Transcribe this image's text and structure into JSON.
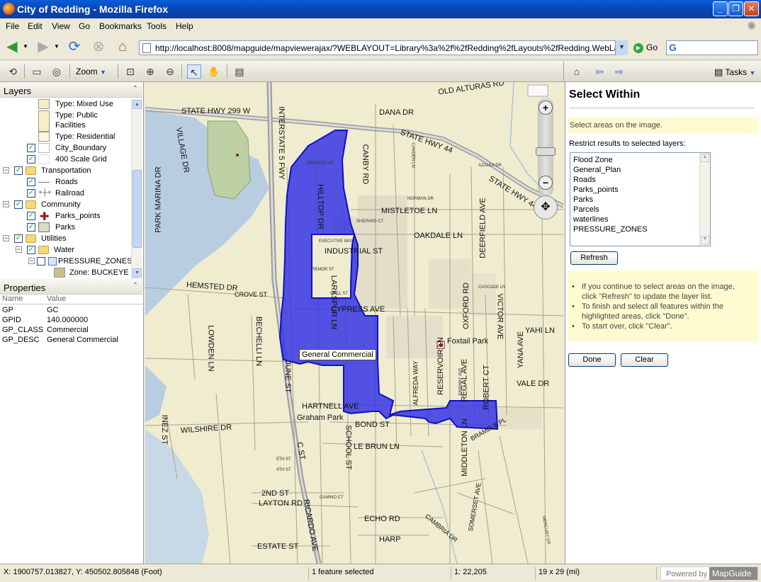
{
  "window": {
    "title": "City of Redding - Mozilla Firefox",
    "minimize": "_",
    "maximize": "❐",
    "close": "✕"
  },
  "menu": [
    "File",
    "Edit",
    "View",
    "Go",
    "Bookmarks",
    "Tools",
    "Help"
  ],
  "nav": {
    "url": "http://localhost:8008/mapguide/mapviewerajax/?WEBLAYOUT=Library%3a%2f%2fRedding%2fLayouts%2fRedding.WebLayout",
    "go_label": "Go",
    "search_value": ""
  },
  "toolbar": {
    "zoom_label": "Zoom",
    "tasks_label": "Tasks"
  },
  "layers_panel": {
    "title": "Layers",
    "items": [
      {
        "label": "Type: Mixed Use",
        "kind": "swatch",
        "color": "#f7edc3"
      },
      {
        "label": "Type: Public",
        "kind": "swatch",
        "color": "#f8efc8"
      },
      {
        "label": "Facilities",
        "kind": "text"
      },
      {
        "label": "Type: Residential",
        "kind": "swatch",
        "color": "#fbf7d9"
      },
      {
        "label": "City_Boundary",
        "kind": "layer",
        "checked": true
      },
      {
        "label": "400 Scale Grid",
        "kind": "layer",
        "checked": true
      },
      {
        "label": "Transportation",
        "kind": "group",
        "checked": true
      },
      {
        "label": "Roads",
        "kind": "layer",
        "checked": true
      },
      {
        "label": "Railroad",
        "kind": "layer",
        "checked": true
      },
      {
        "label": "Community",
        "kind": "group",
        "checked": true
      },
      {
        "label": "Parks_points",
        "kind": "layer",
        "checked": true
      },
      {
        "label": "Parks",
        "kind": "layer",
        "checked": true
      },
      {
        "label": "Utilities",
        "kind": "group",
        "checked": true
      },
      {
        "label": "Water",
        "kind": "group",
        "checked": true
      },
      {
        "label": "PRESSURE_ZONES",
        "kind": "layer",
        "checked": false
      },
      {
        "label": "Zone: BUCKEYE",
        "kind": "swatch",
        "color": "#c8c08a"
      }
    ]
  },
  "properties_panel": {
    "title": "Properties",
    "header": {
      "name": "Name",
      "value": "Value"
    },
    "rows": [
      {
        "name": "GP",
        "value": "GC"
      },
      {
        "name": "GPID",
        "value": "140.000000"
      },
      {
        "name": "GP_CLASS",
        "value": "Commercial"
      },
      {
        "name": "GP_DESC",
        "value": "General Commercial"
      }
    ]
  },
  "map": {
    "tooltip": "General Commercial",
    "highlight_color": "#3030e0",
    "streets": [
      "STATE HWY 299 W",
      "DANA DR",
      "OLD ALTURAS RD",
      "STATE HWY 44",
      "STATE HWY 44",
      "MISTLETOE LN",
      "OAKDALE LN",
      "INDUSTRIAL ST",
      "HEMSTED DR",
      "CROVE ST",
      "CYPRESS AVE",
      "HILLTOP DR",
      "LARKSPUR LN",
      "CANBY RD",
      "DEERFIELD AVE",
      "OXFORD RD",
      "VICTOR AVE",
      "YAHI LN",
      "YANA AVE",
      "VALE DR",
      "BECHELLI LN",
      "LOWDEN LN",
      "INTERSTATE 5 FWY",
      "PARK MARINA DR",
      "VILLAGE DR",
      "HARTNELL AVE",
      "BOND ST",
      "LE BRUN LN",
      "WILSHIRE DR",
      "INEZ ST",
      "SCHOOL ST",
      "C ST",
      "2ND ST",
      "LAYTON RD",
      "ESTATE ST",
      "RICARDO AVE",
      "ECHO RD",
      "HARP",
      "MIDDLETON LN",
      "REGAL AVE",
      "ROBERT CT",
      "RESERVOIR LN",
      "ALFREDA WAY",
      "BRAMBLE PL",
      "SOMERSET AVE",
      "Foxtail Park",
      "Graham Park",
      "CAMINO CT",
      "4TH ST",
      "5TH ST",
      "JUNE ST",
      "MERCURY DR",
      "CAMBRIA DR",
      "AZALEA DR",
      "CAMDEN LN",
      "NORMAN DR",
      "CASCADE LN",
      "FAIRWAY AVE",
      "WALL ST",
      "REMOR ST",
      "EXECUTIVE WAY",
      "SHEPARD CT",
      "PRESIDIO ST"
    ]
  },
  "task_pane": {
    "heading": "Select Within",
    "hint": "Select areas on the image.",
    "restrict_label": "Restrict results to selected layers:",
    "layer_options": [
      "Flood Zone",
      "General_Plan",
      "Roads",
      "Parks_points",
      "Parks",
      "Parcels",
      "waterlines",
      "PRESSURE_ZONES"
    ],
    "refresh_label": "Refresh",
    "instructions": [
      "If you continue to select areas on the image, click \"Refresh\" to update the layer list.",
      "To finish and select all features within the highlighted areas, click \"Done\".",
      "To start over, click \"Clear\"."
    ],
    "done_label": "Done",
    "clear_label": "Clear"
  },
  "status": {
    "coords": "X: 1900757.013827, Y: 450502.805848 (Foot)",
    "selection": "1 feature selected",
    "scale": "1: 22,205",
    "size": "19 x 29 (mi)",
    "powered_by": "Powered by",
    "brand": "MapGuide"
  }
}
